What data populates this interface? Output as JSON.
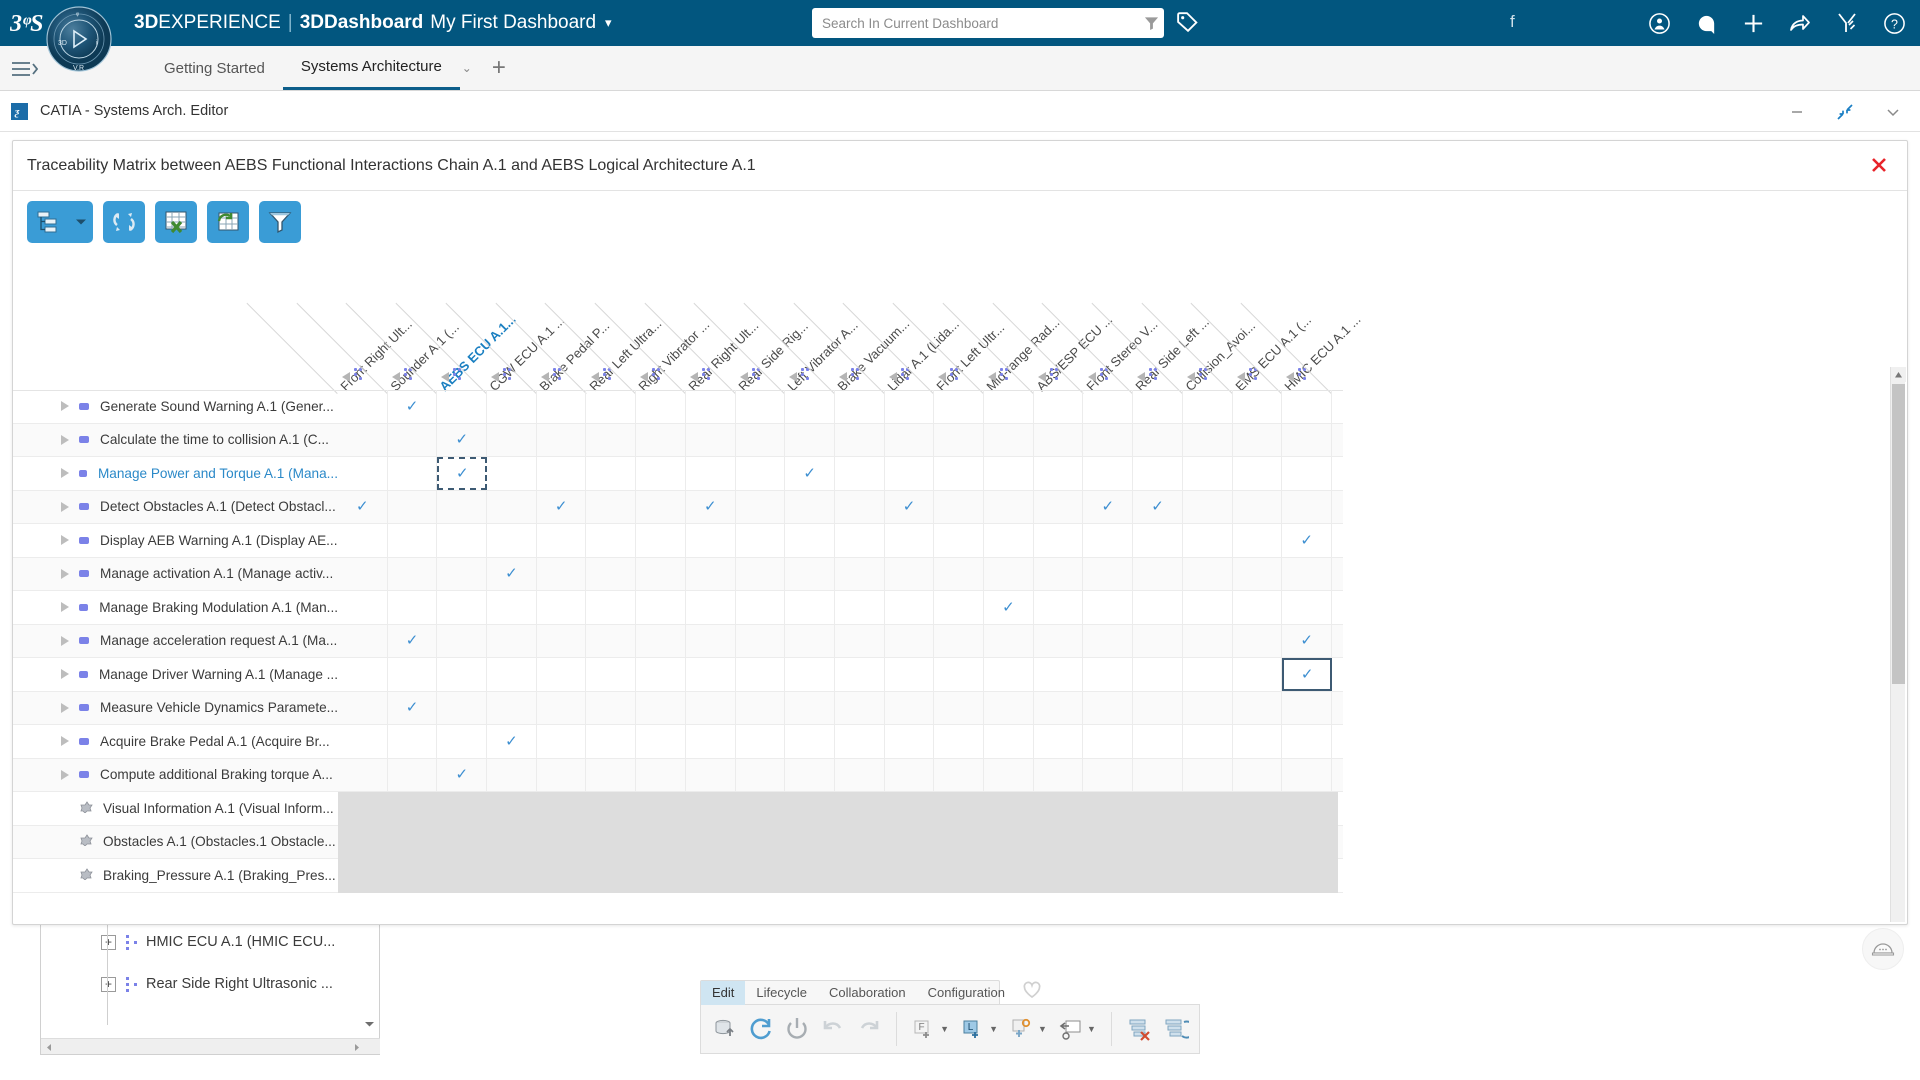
{
  "topbar": {
    "brand_1": "3D",
    "brand_1b": "EXPERIENCE",
    "separator": "|",
    "brand_2": "3D",
    "brand_2b": "Dashboard",
    "dashboard_name": "My First Dashboard",
    "caret": "▼",
    "search_placeholder": "Search In Current Dashboard",
    "f_glyph": "f",
    "icons": [
      "user-icon",
      "notification-icon",
      "add-icon",
      "share-icon",
      "tools-icon",
      "help-icon"
    ]
  },
  "tabstrip": {
    "tabs": [
      {
        "label": "Getting Started",
        "active": false
      },
      {
        "label": "Systems Architecture",
        "active": true
      }
    ],
    "tab_caret": "⌄",
    "add_tab": "+"
  },
  "catia": {
    "app_icon_letter": "♯",
    "title": "CATIA - Systems Arch. Editor",
    "window_controls": [
      "minimize",
      "restore",
      "chevron-down"
    ]
  },
  "dialog": {
    "title": "Traceability Matrix between AEBS Functional Interactions Chain A.1 and AEBS Logical Architecture A.1",
    "close_label": "✕",
    "toolbar_buttons": [
      "tree-view-button",
      "dropdown-arrow-button",
      "refresh-button",
      "export-excel-button",
      "sync-table-button",
      "filter-button"
    ]
  },
  "matrix": {
    "columns": [
      "Front Right Ult...",
      "Sounder A.1 (...",
      "AEBS ECU A.1...",
      "CGW ECU A.1 ...",
      "Brake Pedal P...",
      "Rear Left Ultra...",
      "Right Vibrator ...",
      "Rear Right Ult...",
      "Rear Side Rig...",
      "Left Vibrator A...",
      "Brake Vacuum...",
      "Lidar A.1 (Lida...",
      "Front Left Ultr...",
      "Mid-range Rad...",
      "ABS/ESP ECU ...",
      "Front Stereo V...",
      "Rear Side Left ...",
      "Collision_Avoi...",
      "EMS ECU A.1 (...",
      "HMIC ECU A.1 ..."
    ],
    "selected_column_index": 2,
    "rows": [
      {
        "label": "Generate Sound Warning A.1 (Gener...",
        "kind": "function",
        "highlight": false
      },
      {
        "label": "Calculate the time to collision A.1 (C...",
        "kind": "function",
        "highlight": false
      },
      {
        "label": "Manage Power and Torque A.1 (Mana...",
        "kind": "function",
        "highlight": true
      },
      {
        "label": "Detect Obstacles A.1 (Detect Obstacl...",
        "kind": "function",
        "highlight": false
      },
      {
        "label": "Display AEB Warning A.1 (Display AE...",
        "kind": "function",
        "highlight": false
      },
      {
        "label": "Manage activation A.1 (Manage activ...",
        "kind": "function",
        "highlight": false
      },
      {
        "label": "Manage Braking Modulation A.1 (Man...",
        "kind": "function",
        "highlight": false
      },
      {
        "label": "Manage acceleration request A.1 (Ma...",
        "kind": "function",
        "highlight": false
      },
      {
        "label": "Manage Driver Warning A.1 (Manage ...",
        "kind": "function",
        "highlight": false
      },
      {
        "label": "Measure Vehicle Dynamics Paramete...",
        "kind": "function",
        "highlight": false
      },
      {
        "label": "Acquire Brake Pedal A.1 (Acquire Br...",
        "kind": "function",
        "highlight": false
      },
      {
        "label": "Compute additional Braking torque A...",
        "kind": "function",
        "highlight": false
      },
      {
        "label": "Visual Information A.1 (Visual Inform...",
        "kind": "flow",
        "highlight": false
      },
      {
        "label": "Obstacles A.1 (Obstacles.1 Obstacle...",
        "kind": "flow",
        "highlight": false
      },
      {
        "label": "Braking_Pressure A.1 (Braking_Pres...",
        "kind": "flow",
        "highlight": false
      }
    ],
    "check_glyph": "✓",
    "cells": [
      {
        "row": 0,
        "col": 1,
        "state": "check"
      },
      {
        "row": 1,
        "col": 2,
        "state": "check"
      },
      {
        "row": 2,
        "col": 2,
        "state": "check-dashed-focus"
      },
      {
        "row": 2,
        "col": 9,
        "state": "check"
      },
      {
        "row": 3,
        "col": 0,
        "state": "check"
      },
      {
        "row": 3,
        "col": 4,
        "state": "check"
      },
      {
        "row": 3,
        "col": 7,
        "state": "check"
      },
      {
        "row": 3,
        "col": 11,
        "state": "check"
      },
      {
        "row": 3,
        "col": 15,
        "state": "check"
      },
      {
        "row": 3,
        "col": 16,
        "state": "check"
      },
      {
        "row": 4,
        "col": 19,
        "state": "check"
      },
      {
        "row": 5,
        "col": 3,
        "state": "check"
      },
      {
        "row": 6,
        "col": 13,
        "state": "check"
      },
      {
        "row": 7,
        "col": 1,
        "state": "check"
      },
      {
        "row": 7,
        "col": 19,
        "state": "check"
      },
      {
        "row": 8,
        "col": 19,
        "state": "check-solid-selected"
      },
      {
        "row": 9,
        "col": 1,
        "state": "check"
      },
      {
        "row": 10,
        "col": 3,
        "state": "check"
      },
      {
        "row": 11,
        "col": 2,
        "state": "check"
      }
    ],
    "disabled_rows_from": 12
  },
  "tree_panel": {
    "nodes": [
      {
        "expander": "+",
        "label": "HMIC ECU A.1 (HMIC ECU..."
      },
      {
        "expander": "+",
        "label": "Rear Side Right Ultrasonic ..."
      }
    ]
  },
  "bottom_bar": {
    "tabs": [
      {
        "label": "Edit",
        "active": true
      },
      {
        "label": "Lifecycle",
        "active": false
      },
      {
        "label": "Collaboration",
        "active": false
      },
      {
        "label": "Configuration",
        "active": false
      }
    ],
    "favorite_icon": "heart-icon",
    "tools": [
      "save-to-database-icon",
      "refresh-icon",
      "power-icon",
      "undo-icon",
      "redo-icon",
      "add-function-icon",
      "add-logical-icon",
      "add-port-icon",
      "insert-icon",
      "delete-tree-icon",
      "reorder-tree-icon"
    ]
  },
  "helper": {
    "icon": "helmet-icon"
  },
  "colors": {
    "topbar_blue": "#02567f",
    "accent_blue": "#3d8fd1",
    "selected_text": "#1a7fc1",
    "toolbar_button": "#3a9cd6",
    "close_red": "#e8232a"
  }
}
